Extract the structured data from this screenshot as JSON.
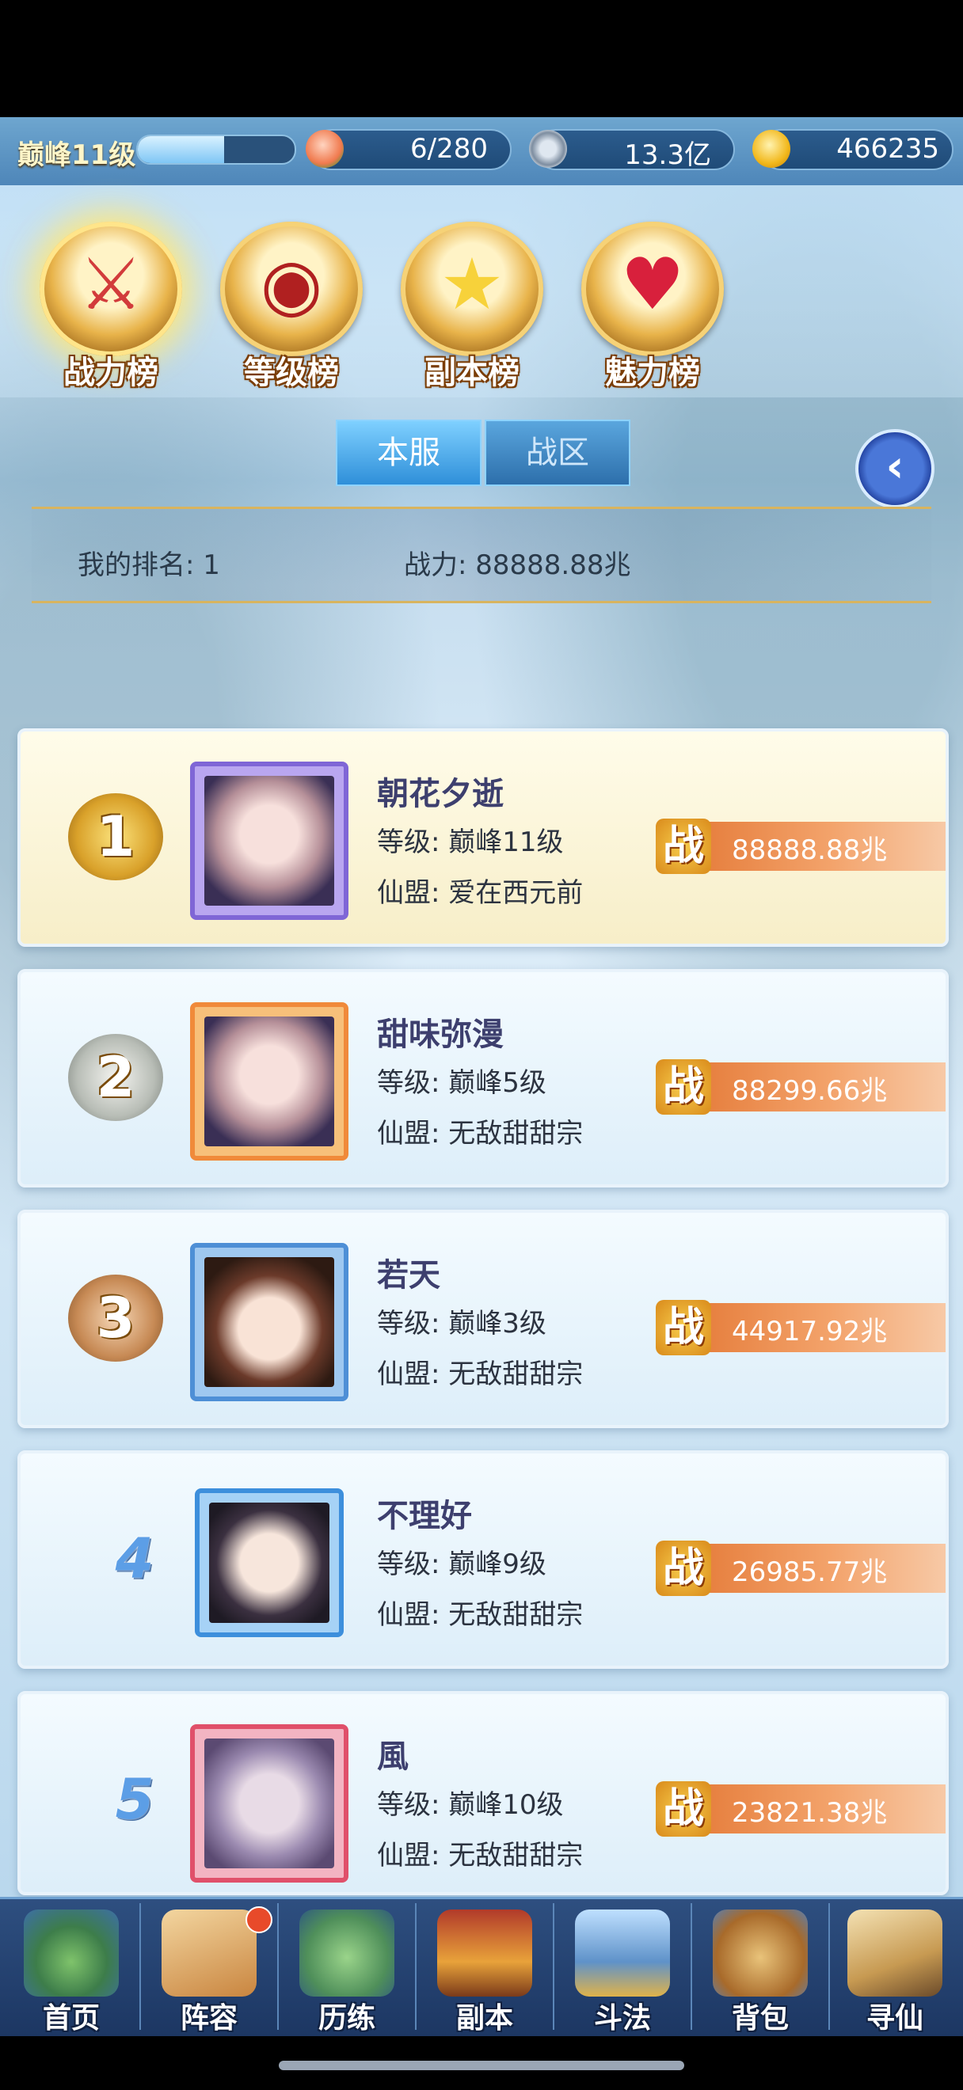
{
  "status": {
    "level": "巅峰11级",
    "exp_fraction": 0.55,
    "peach": "6/280",
    "coin": "13.3亿",
    "gold": "466235"
  },
  "tabs": [
    {
      "label": "战力榜",
      "icon": "sword-emblem-icon",
      "active": true
    },
    {
      "label": "等级榜",
      "icon": "drum-emblem-icon",
      "active": false
    },
    {
      "label": "副本榜",
      "icon": "stars-emblem-icon",
      "active": false
    },
    {
      "label": "魅力榜",
      "icon": "heart-emblem-icon",
      "active": false
    }
  ],
  "server": {
    "local": "本服",
    "zone": "战区"
  },
  "my_rank": {
    "rank_label": "我的排名: 1",
    "power_label": "战力: 88888.88兆"
  },
  "players": [
    {
      "rank": "1",
      "name": "朝花夕逝",
      "level": "等级: 巅峰11级",
      "guild": "仙盟: 爱在西元前",
      "power": "88888.88兆"
    },
    {
      "rank": "2",
      "name": "甜味弥漫",
      "level": "等级: 巅峰5级",
      "guild": "仙盟: 无敌甜甜宗",
      "power": "88299.66兆"
    },
    {
      "rank": "3",
      "name": "若天",
      "level": "等级: 巅峰3级",
      "guild": "仙盟: 无敌甜甜宗",
      "power": "44917.92兆"
    },
    {
      "rank": "4",
      "name": "不理好",
      "level": "等级: 巅峰9级",
      "guild": "仙盟: 无敌甜甜宗",
      "power": "26985.77兆"
    },
    {
      "rank": "5",
      "name": "風",
      "level": "等级: 巅峰10级",
      "guild": "仙盟: 无敌甜甜宗",
      "power": "23821.38兆"
    }
  ],
  "power_icon_text": "战",
  "nav": [
    {
      "label": "首页",
      "icon": "home-island-icon"
    },
    {
      "label": "阵容",
      "icon": "cards-icon"
    },
    {
      "label": "历练",
      "icon": "turtle-icon"
    },
    {
      "label": "副本",
      "icon": "temple-gate-icon"
    },
    {
      "label": "斗法",
      "icon": "tower-icon"
    },
    {
      "label": "背包",
      "icon": "backpack-icon"
    },
    {
      "label": "寻仙",
      "icon": "scroll-icon"
    }
  ],
  "colors": {
    "accent": "#e2732f",
    "gold": "#e8b34a",
    "nav_bg": "#1c3662"
  }
}
